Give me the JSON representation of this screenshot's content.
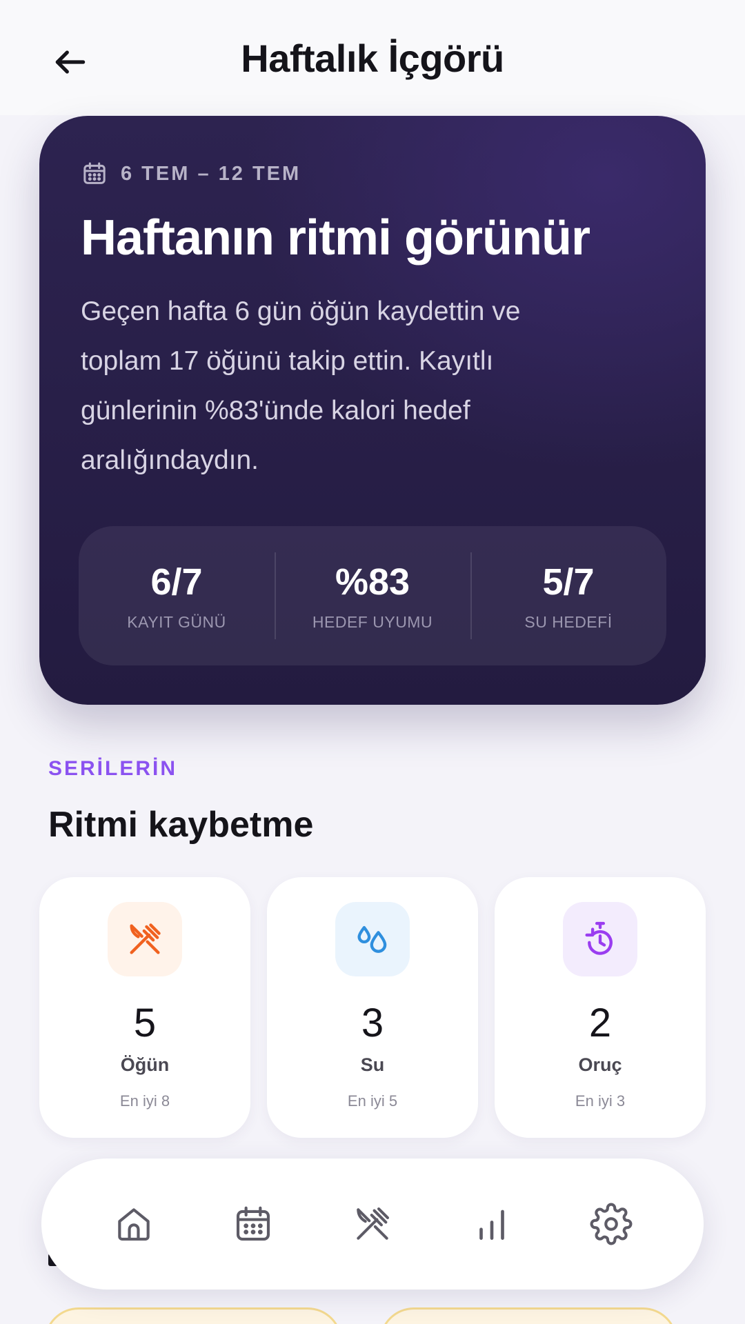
{
  "header": {
    "title": "Haftalık İçgörü",
    "back_icon": "arrow-left-icon"
  },
  "hero": {
    "date_range": "6 TEM – 12 TEM",
    "date_icon": "calendar-icon",
    "title": "Haftanın ritmi görünür",
    "body": "Geçen hafta 6 gün öğün kaydettin ve toplam 17 öğünü takip ettin. Kayıtlı günlerinin %83'ünde kalori hedef aralığındaydın.",
    "stats": [
      {
        "value": "6/7",
        "label": "KAYIT GÜNÜ"
      },
      {
        "value": "%83",
        "label": "HEDEF UYUMU"
      },
      {
        "value": "5/7",
        "label": "SU HEDEFİ"
      }
    ]
  },
  "streaks": {
    "eyebrow": "SERİLERİN",
    "title": "Ritmi kaybetme",
    "items": [
      {
        "icon": "fork-knife-icon",
        "value": "5",
        "name": "Öğün",
        "best": "En iyi 8",
        "accent": "#f0611f",
        "tint": "#fff3ea"
      },
      {
        "icon": "water-drops-icon",
        "value": "3",
        "name": "Su",
        "best": "En iyi 5",
        "accent": "#2f8fde",
        "tint": "#eaf4fd"
      },
      {
        "icon": "timer-icon",
        "value": "2",
        "name": "Oruç",
        "best": "En iyi 3",
        "accent": "#9a3df0",
        "tint": "#f3ecfd"
      }
    ]
  },
  "bottom_nav": {
    "items": [
      {
        "icon": "home-icon"
      },
      {
        "icon": "calendar-icon"
      },
      {
        "icon": "fork-knife-icon"
      },
      {
        "icon": "bar-chart-icon"
      },
      {
        "icon": "settings-gear-icon"
      }
    ]
  },
  "colors": {
    "accent_purple": "#8b52f0",
    "hero_bg": "#2d2350"
  }
}
